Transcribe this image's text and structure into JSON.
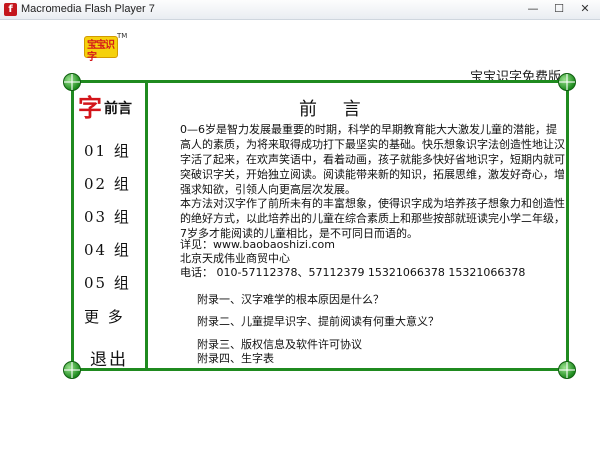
{
  "window": {
    "title": "Macromedia Flash Player 7",
    "icon": "flash-player-icon",
    "minimize": "—",
    "maximize": "☐",
    "close": "✕"
  },
  "logo": {
    "text": "宝宝识字",
    "tm": "TM"
  },
  "brand_title": "宝宝识字免费版",
  "sidebar": {
    "zi_char": "字",
    "preface_label": "前言",
    "items": [
      {
        "label": "01 组"
      },
      {
        "label": "02 组"
      },
      {
        "label": "03 组"
      },
      {
        "label": "04 组"
      },
      {
        "label": "05 组"
      },
      {
        "label": "更 多"
      }
    ],
    "exit_label": "退出"
  },
  "main": {
    "title": "前 言",
    "paragraph1": "0—6岁是智力发展最重要的时期，科学的早期教育能大大激发儿童的潜能，提高人的素质，为将来取得成功打下最坚实的基础。快乐想象识字法创造性地让汉字活了起来，在欢声笑语中，看着动画，孩子就能多快好省地识字，短期内就可突破识字关，开始独立阅读。阅读能带来新的知识，拓展思维，激发好奇心，增强求知欲，引领人向更高层次发展。",
    "paragraph2": "本方法对汉字作了前所未有的丰富想象，使得识字成为培养孩子想象力和创造性的绝好方式，以此培养出的儿童在综合素质上和那些按部就班读完小学二年级，7岁多才能阅读的儿童相比，是不可同日而语的。",
    "website": "详见：www.baobaoshizi.com",
    "company": "北京天成伟业商贸中心",
    "phone": "电话： 010-57112378、57112379      15321066378    15321066378",
    "appendices": [
      "附录一、汉字难学的根本原因是什么？",
      "附录二、儿童提早识字、提前阅读有何重大意义？",
      "附录三、版权信息及软件许可协议",
      "附录四、生字表"
    ]
  },
  "colors": {
    "frame": "#1f8a1f",
    "accent_red": "#d3151a",
    "logo_yellow": "#f5d10c"
  }
}
